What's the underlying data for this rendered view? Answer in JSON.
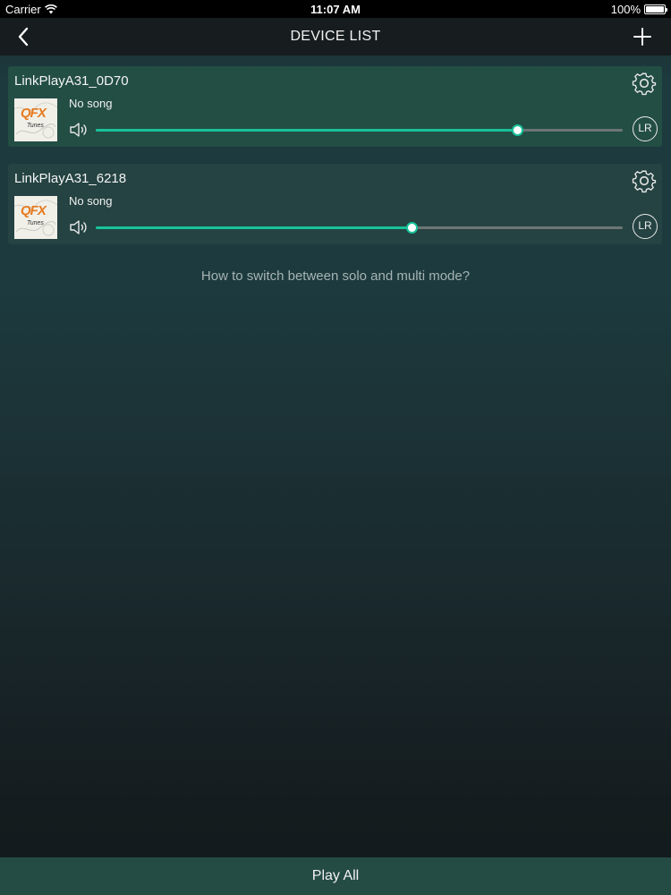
{
  "status_bar": {
    "carrier": "Carrier",
    "time": "11:07 AM",
    "battery": "100%"
  },
  "nav": {
    "title": "DEVICE LIST",
    "back_icon": "chevron-left-icon",
    "add_icon": "plus-icon"
  },
  "devices": [
    {
      "name": "LinkPlayA31_0D70",
      "song": "No song",
      "volume_fraction": 0.8,
      "channel": "LR",
      "art_brand": "QFX",
      "art_sub": "Tunes"
    },
    {
      "name": "LinkPlayA31_6218",
      "song": "No song",
      "volume_fraction": 0.6,
      "channel": "LR",
      "art_brand": "QFX",
      "art_sub": "Tunes"
    }
  ],
  "help_link": "How to switch between solo and multi mode?",
  "play_all": "Play All",
  "colors": {
    "accent": "#18c29a",
    "bottom_bar": "#254b45",
    "nav_bar": "#171c1e"
  }
}
